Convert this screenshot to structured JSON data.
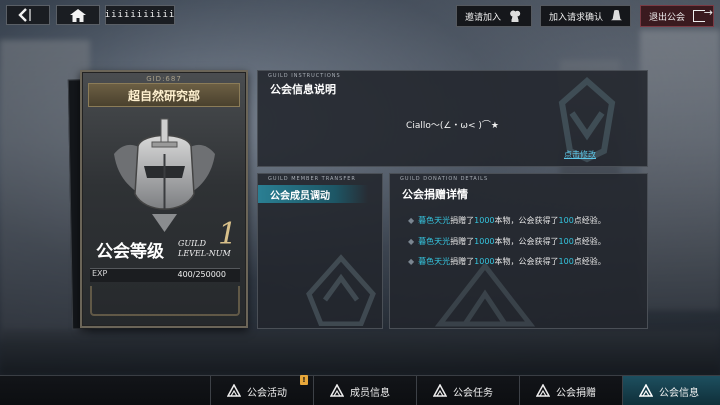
{
  "topbar": {
    "back_icon": "back-arrow-icon",
    "home_icon": "home-icon",
    "title": "iiiiiiiiiii",
    "invite_label": "邀请加入",
    "request_label": "加入请求确认",
    "exit_label": "退出公会"
  },
  "guild_card": {
    "gid": "GID:687",
    "name": "超自然研究部",
    "level_label": "公会等级",
    "level_sub_en_1": "GUILD",
    "level_sub_en_2": "LEVEL-NUM",
    "level": "1",
    "exp_label": "EXP",
    "exp_value": "400/250000",
    "exp_progress": 0.0016
  },
  "instructions": {
    "tag": "GUILD INSTRUCTIONS",
    "title": "公会信息说明",
    "text": "Ciallo～(∠・ω< )⌒★",
    "edit_link": "点击修改"
  },
  "member_transfer": {
    "tag": "GUILD MEMBER TRANSFER",
    "title": "公会成员调动"
  },
  "donation": {
    "tag": "GUILD DONATION DETAILS",
    "title": "公会捐赠详情",
    "entries": [
      {
        "player": "暮色天光",
        "action": "捐赠了",
        "amount": "1000",
        "unit": "本物，公会获得了",
        "points": "100",
        "suffix": "点经验。"
      },
      {
        "player": "暮色天光",
        "action": "捐赠了",
        "amount": "1000",
        "unit": "本物，公会获得了",
        "points": "100",
        "suffix": "点经验。"
      },
      {
        "player": "暮色天光",
        "action": "捐赠了",
        "amount": "1000",
        "unit": "本物，公会获得了",
        "points": "100",
        "suffix": "点经验。"
      }
    ]
  },
  "bottom_tabs": [
    {
      "label": "公会活动",
      "icon": "guild-activity-icon",
      "badge": "!"
    },
    {
      "label": "成员信息",
      "icon": "member-info-icon"
    },
    {
      "label": "公会任务",
      "icon": "guild-task-icon"
    },
    {
      "label": "公会捐赠",
      "icon": "guild-donate-icon"
    },
    {
      "label": "公会信息",
      "icon": "guild-info-icon",
      "active": true
    }
  ],
  "colors": {
    "accent": "#35c6e0",
    "gold": "#d8c08a",
    "active_tab": "#1d4f5f",
    "exit_btn": "#3a1a1f"
  }
}
